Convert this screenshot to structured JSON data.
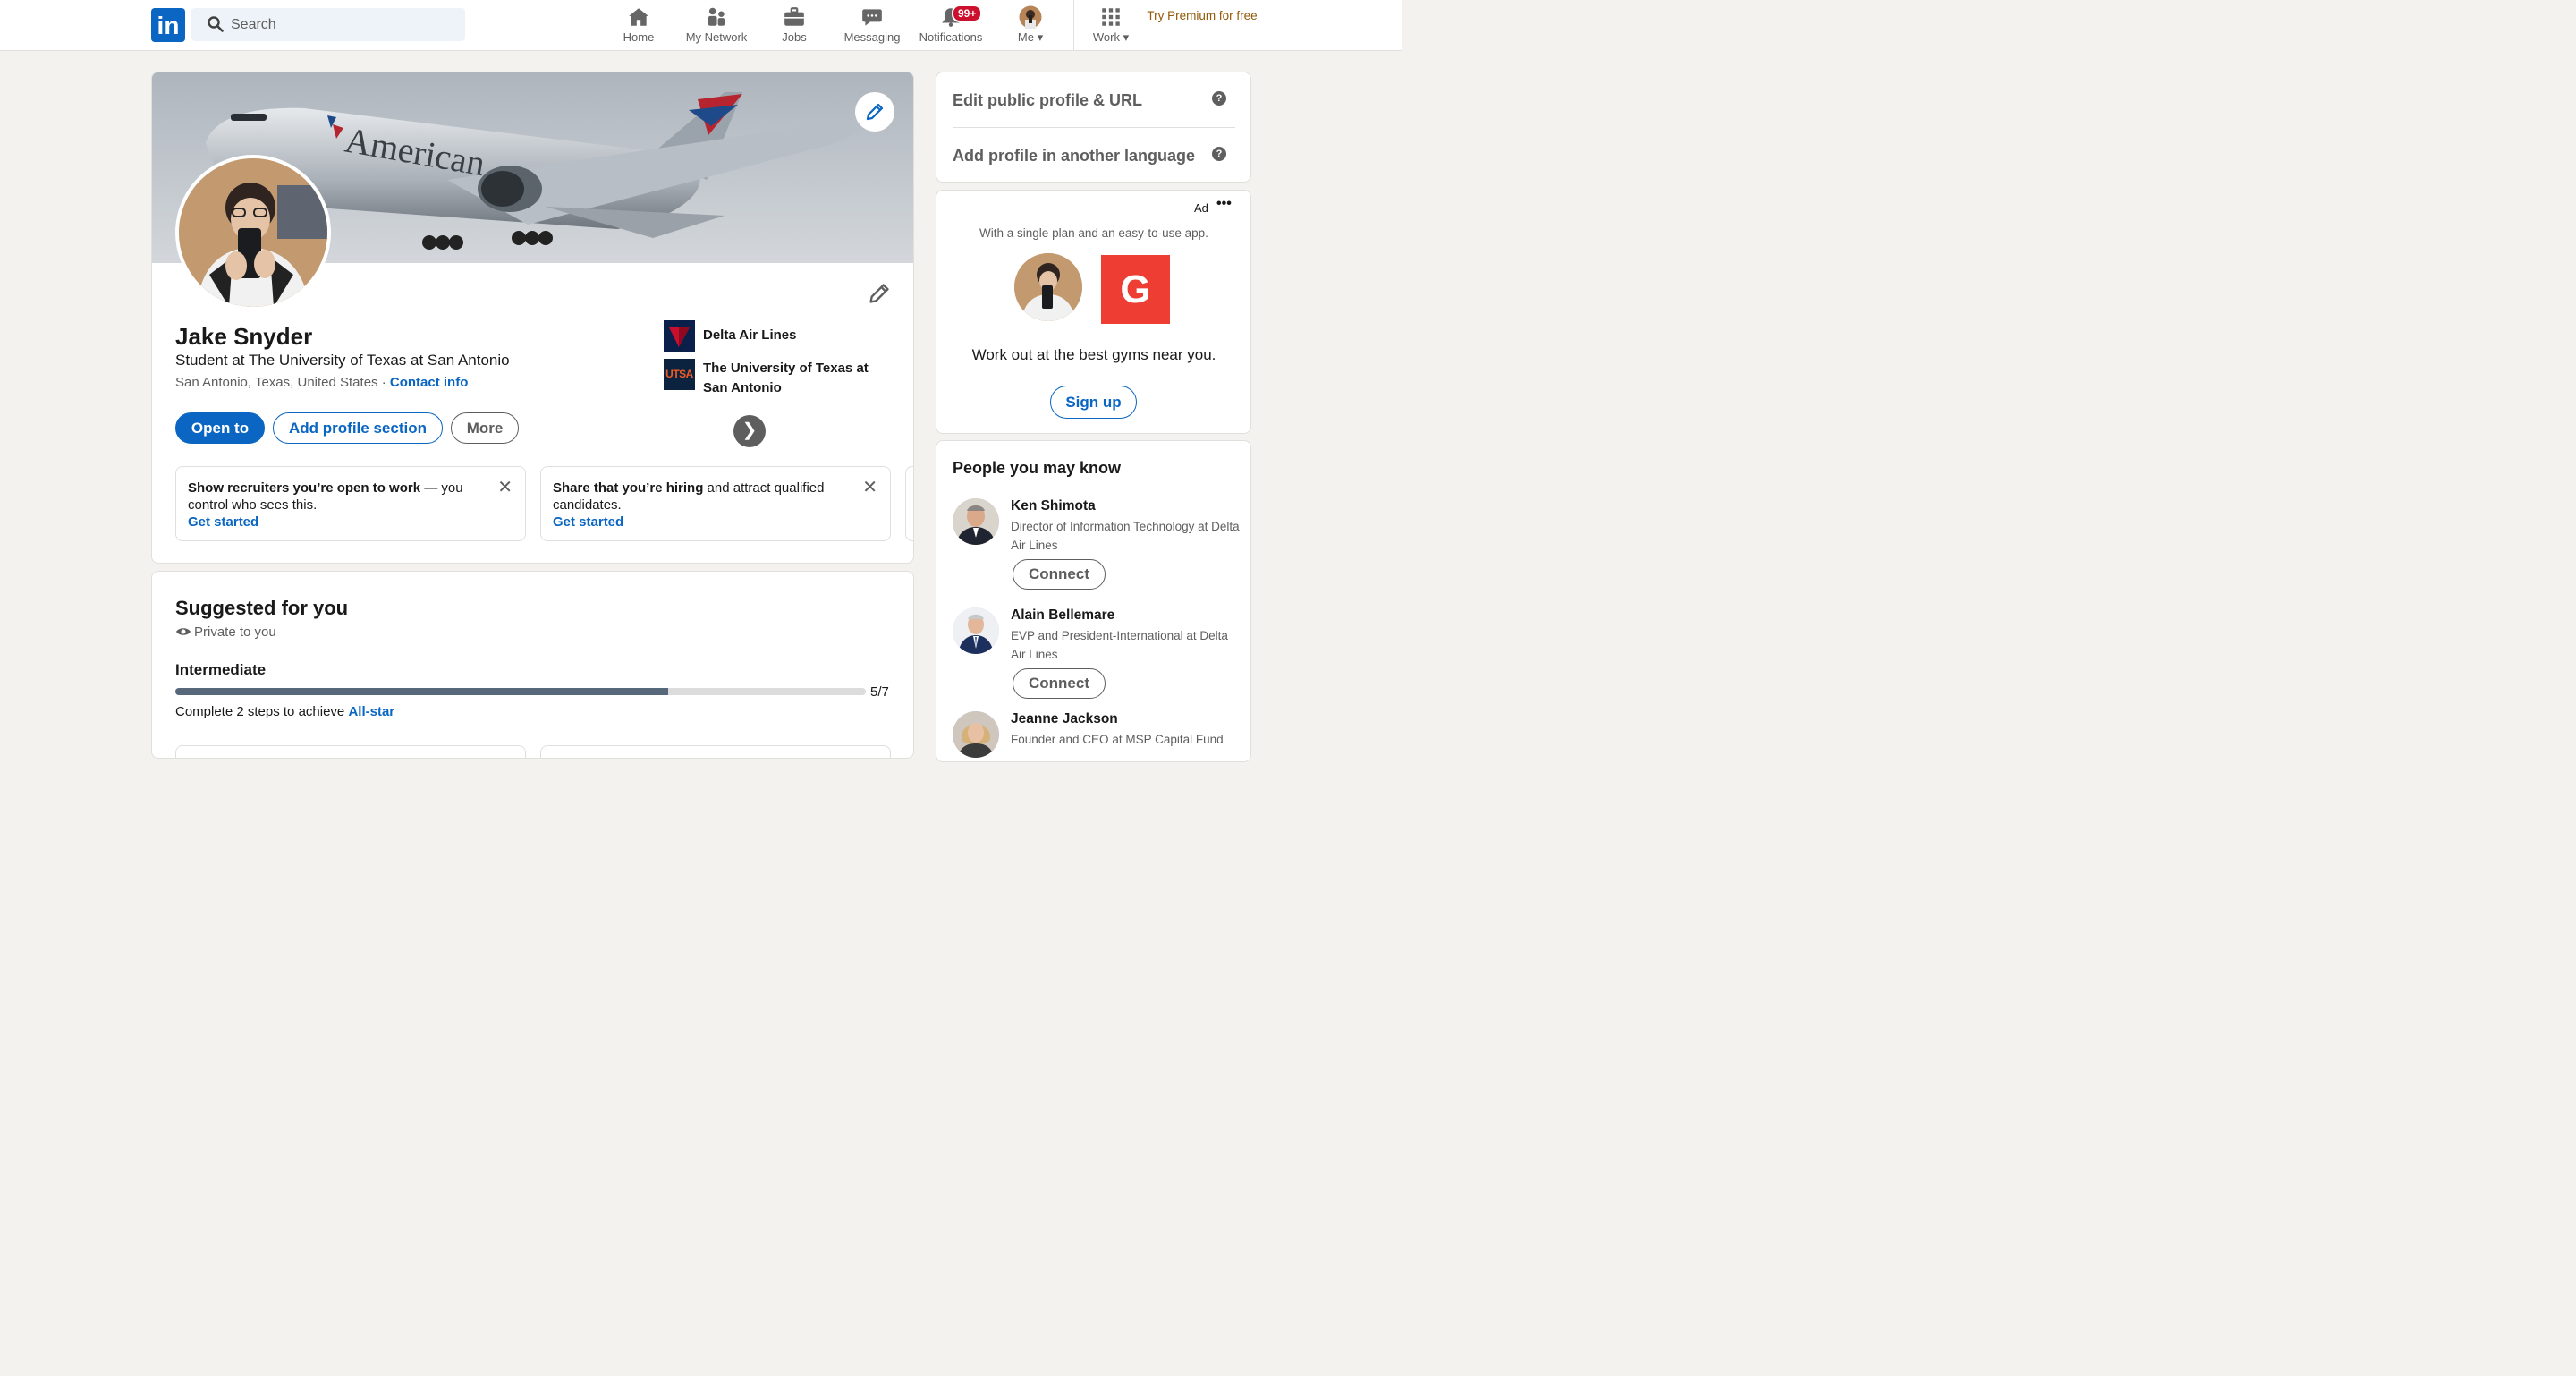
{
  "nav": {
    "search_placeholder": "Search",
    "items": [
      {
        "label": "Home",
        "icon": "home-icon"
      },
      {
        "label": "My Network",
        "icon": "network-icon"
      },
      {
        "label": "Jobs",
        "icon": "briefcase-icon"
      },
      {
        "label": "Messaging",
        "icon": "chat-icon"
      },
      {
        "label": "Notifications",
        "icon": "bell-icon",
        "badge": "99+"
      },
      {
        "label": "Me",
        "icon": "avatar"
      },
      {
        "label": "Work",
        "icon": "grid-icon"
      }
    ],
    "premium": "Try Premium for free",
    "brand_color": "#0a66c2",
    "badge_color": "#cb112d"
  },
  "profile": {
    "name": "Jake Snyder",
    "headline": "Student at The University of Texas at San Antonio",
    "location": "San Antonio, Texas, United States",
    "contact_info": "Contact info",
    "banner_text": "American",
    "orgs": [
      {
        "name": "Delta Air Lines",
        "logo": "delta-logo"
      },
      {
        "name": "The University of Texas at San Antonio",
        "logo": "utsa-logo",
        "logo_text": "UTSA"
      }
    ],
    "buttons": {
      "open_to": "Open to",
      "add_section": "Add profile section",
      "more": "More"
    },
    "promos": [
      {
        "bold": "Show recruiters you’re open to work",
        "rest": " — you control who sees this.",
        "cta": "Get started"
      },
      {
        "bold": "Share that you’re hiring",
        "rest": " and attract qualified candidates.",
        "cta": "Get started"
      }
    ]
  },
  "suggested": {
    "title": "Suggested for you",
    "privacy": "Private to you",
    "level": "Intermediate",
    "progress_value": 5,
    "progress_max": 7,
    "progress_label": "5/7",
    "steps_text": "Complete 2 steps to achieve ",
    "steps_link": "All-star"
  },
  "sidebar": {
    "links": [
      "Edit public profile & URL",
      "Add profile in another language"
    ],
    "ad": {
      "label": "Ad",
      "description": "With a single plan and an easy-to-use app.",
      "brand_letter": "G",
      "tagline": "Work out at the best gyms near you.",
      "cta": "Sign up",
      "brand_color": "#ee3e34"
    },
    "pymk": {
      "title": "People you may know",
      "people": [
        {
          "name": "Ken Shimota",
          "role": "Director of Information Technology at Delta Air Lines",
          "button": "Connect"
        },
        {
          "name": "Alain Bellemare",
          "role": "EVP and President-International at Delta Air Lines",
          "button": "Connect"
        },
        {
          "name": "Jeanne Jackson",
          "role": "Founder and CEO at MSP Capital Fund"
        }
      ]
    }
  }
}
